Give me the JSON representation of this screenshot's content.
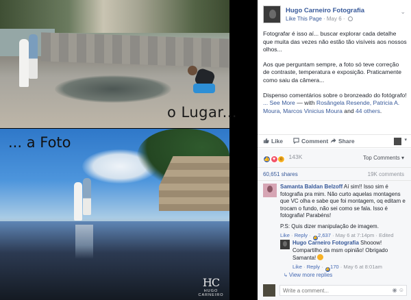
{
  "photo": {
    "label_top": "o Lugar...",
    "label_bottom": "... a Foto",
    "watermark_mono": "HC",
    "watermark_name": "HUGO CARNEIRO"
  },
  "post": {
    "page_name": "Hugo Carneiro Fotografia",
    "like_page": "Like This Page",
    "date": "May 6",
    "paragraphs": [
      "Fotografar é isso aí... buscar explorar cada detalhe que muita das vezes não estão tão visíveis aos nossos olhos...",
      "Aos que perguntam sempre, a foto só teve correção de contraste, temperatura e exposição. Praticamente como saiu da câmera...",
      "Dispenso comentários sobre o bronzeado do fotógrafo!"
    ],
    "see_more": "... See More",
    "with_prefix": "— with",
    "tagged": "Rosângela Resende, Patricia A. Moura, Marcos Vinicius Moura",
    "and_text": "and",
    "others": "44 others",
    "period": "."
  },
  "actions": {
    "like": "Like",
    "comment": "Comment",
    "share": "Share"
  },
  "reactions": {
    "count": "143K",
    "sort": "Top Comments ▾",
    "shares": "60,651 shares",
    "comments_count": "19K comments"
  },
  "comment": {
    "author": "Samanta Baldan Belzoff",
    "text": "Aí sim!! Isso sim é fotografia pra mim. Não curto aquelas montagens que VC olha e sabe que foi montagem, oq editam e trocam o fundo, não sei como se fala. Isso é fotografia! Parabéns!",
    "ps": "P.S: Quis dizer manipulação de imagem.",
    "like": "Like",
    "reply": "Reply",
    "likes": "2,637",
    "time": "May 6 at 7:14pm",
    "edited": "Edited"
  },
  "reply": {
    "author": "Hugo Carneiro Fotografia",
    "text": "Shooow! Compartilho da msm opinião! Obrigado Samanta!",
    "like": "Like",
    "reply": "Reply",
    "likes": "170",
    "time": "May 6 at 8:01am"
  },
  "more_replies": "View more replies",
  "write_placeholder": "Write a comment...",
  "colors": {
    "link": "#365899",
    "like_blue": "#4267b2",
    "love": "#f25268",
    "wow": "#f7b125"
  }
}
